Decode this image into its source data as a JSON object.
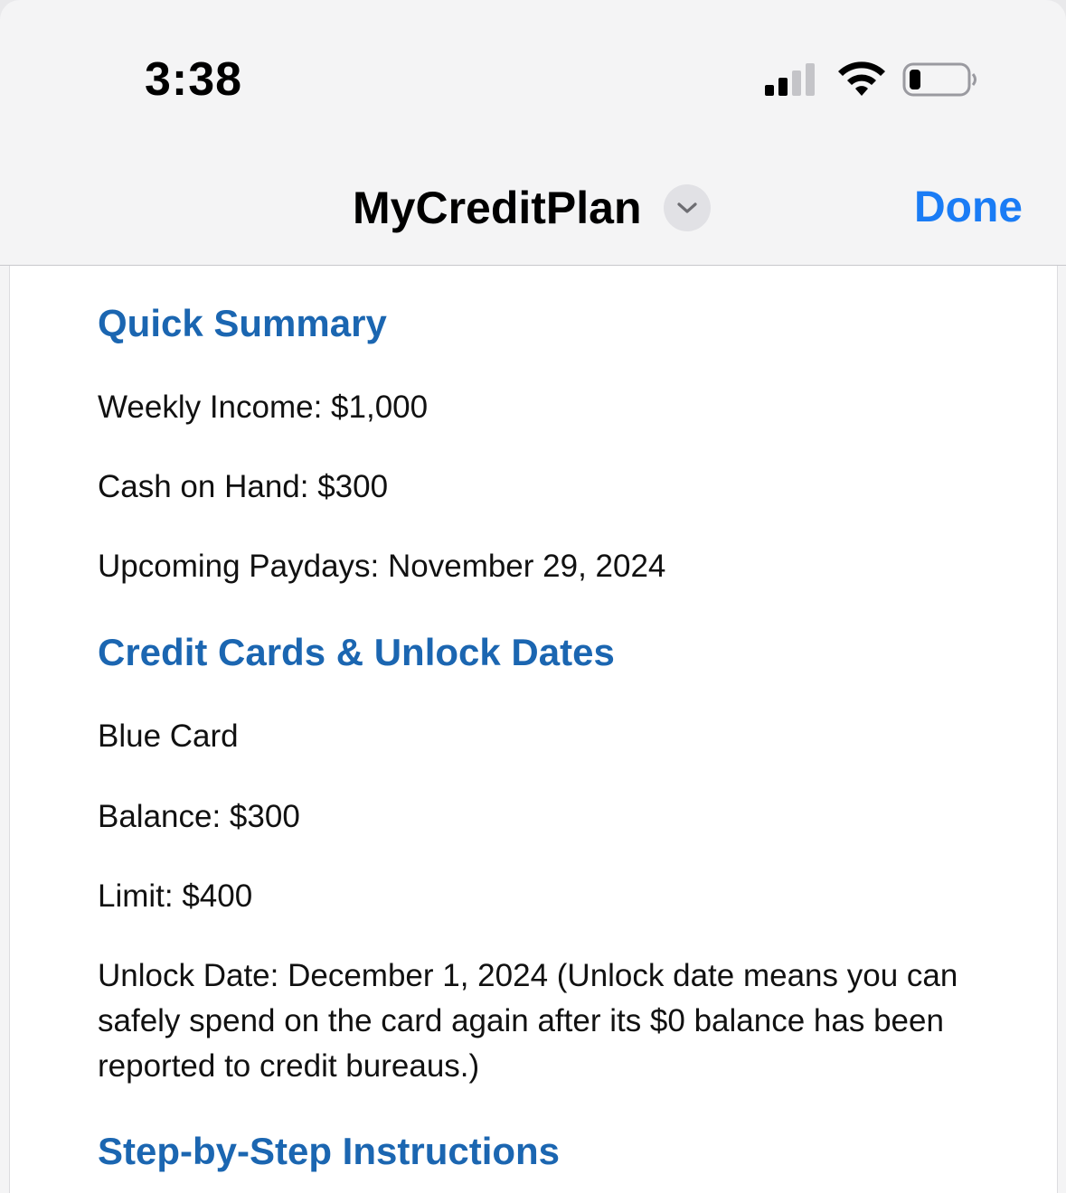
{
  "status_bar": {
    "time": "3:38"
  },
  "nav": {
    "title": "MyCreditPlan",
    "done_label": "Done"
  },
  "sections": {
    "quick_summary": {
      "heading": "Quick Summary",
      "weekly_income": "Weekly Income: $1,000",
      "cash_on_hand": "Cash on Hand: $300",
      "upcoming_paydays": "Upcoming Paydays: November 29, 2024"
    },
    "credit_cards": {
      "heading": "Credit Cards & Unlock Dates",
      "card_name": "Blue Card",
      "balance": "Balance: $300",
      "limit": "Limit: $400",
      "unlock_date": "Unlock Date: December 1, 2024 (Unlock date means you can safely spend on the card again after its $0 balance has been reported to credit bureaus.)"
    },
    "instructions": {
      "heading": "Step-by-Step Instructions"
    }
  },
  "colors": {
    "heading": "#1b66b1",
    "accent": "#1a7cf5"
  }
}
